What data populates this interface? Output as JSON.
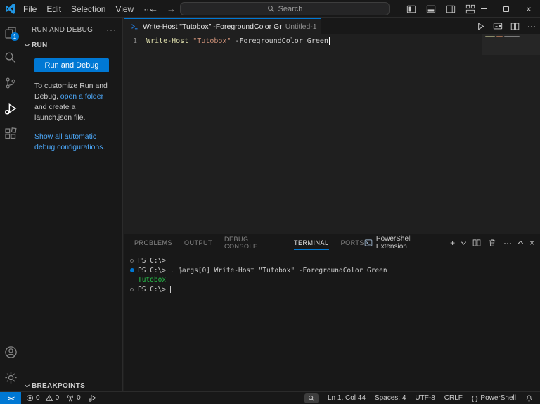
{
  "glyphs": {
    "ellipsis": "···",
    "back_arrow": "←",
    "forward_arrow": "→",
    "close": "×",
    "plus": "+"
  },
  "titlebar": {
    "menus": [
      "File",
      "Edit",
      "Selection",
      "View",
      "···"
    ],
    "search": {
      "placeholder": "Search"
    }
  },
  "activity_bar": {
    "explorer_badge": "1"
  },
  "sidebar": {
    "title": "RUN AND DEBUG",
    "more_actions": "···",
    "run_section": "RUN",
    "run_button": "Run and Debug",
    "hint": {
      "pre": "To customize Run and Debug, ",
      "link": "open a folder",
      "post": " and create a launch.json file."
    },
    "auto_config_link": "Show all automatic debug configurations.",
    "breakpoints_section": "BREAKPOINTS"
  },
  "editor": {
    "tab": {
      "title": "Write-Host \"Tutobox\" -ForegroundColor Gr",
      "secondary": "Untitled-1"
    },
    "line_number": "1",
    "code_tokens": [
      {
        "text": "Write-Host",
        "color": "#dcdcaa"
      },
      {
        "text": " ",
        "color": "#d4d4d4"
      },
      {
        "text": "\"Tutobox\"",
        "color": "#ce9178"
      },
      {
        "text": " -ForegroundColor Green",
        "color": "#d4d4d4"
      }
    ]
  },
  "panel": {
    "tabs": [
      "PROBLEMS",
      "OUTPUT",
      "DEBUG CONSOLE",
      "TERMINAL",
      "PORTS"
    ],
    "active_tab": "TERMINAL",
    "shell_label": "PowerShell Extension",
    "terminal": {
      "lines": [
        {
          "marker": "hollow",
          "segments": [
            {
              "text": "PS C:\\>",
              "color": "#cccccc"
            }
          ]
        },
        {
          "marker": "filled",
          "segments": [
            {
              "text": "PS C:\\> . $args[0] Write-Host \"Tutobox\" -ForegroundColor Green",
              "color": "#cccccc"
            }
          ]
        },
        {
          "marker": "none",
          "segments": [
            {
              "text": "Tutobox",
              "color": "#27c24a"
            }
          ]
        },
        {
          "marker": "hollow",
          "segments": [
            {
              "text": "PS C:\\> ",
              "color": "#cccccc"
            }
          ],
          "cursor": true
        }
      ]
    }
  },
  "statusbar": {
    "errors": "0",
    "warnings": "0",
    "ports": "0",
    "cursor_position": "Ln 1, Col 44",
    "indentation": "Spaces: 4",
    "encoding": "UTF-8",
    "eol": "CRLF",
    "language": "PowerShell",
    "braces_glyph": "{ }"
  },
  "colors": {
    "accent": "#0078d4",
    "link": "#4daafc",
    "terminal_green": "#27c24a",
    "string": "#ce9178",
    "function": "#dcdcaa"
  }
}
